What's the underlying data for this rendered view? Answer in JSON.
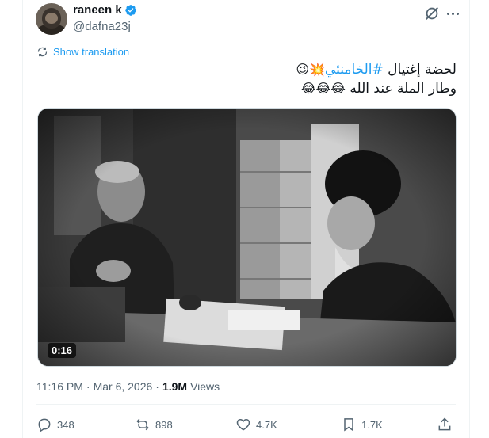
{
  "author": {
    "display_name": "raneen k",
    "handle": "@dafna23j",
    "verified": true
  },
  "translate": {
    "label": "Show translation"
  },
  "tweet": {
    "line1_prefix": "لحضة إغتيال ",
    "line1_hashtag": "#الخامنئي",
    "line1_emojis": "💥😉",
    "line2_text": "وطار الملة عند الله ",
    "line2_emojis": "😂😂😂"
  },
  "media": {
    "duration": "0:16"
  },
  "meta": {
    "time": "11:16 PM",
    "separator1": "·",
    "date": "Mar 6, 2026",
    "separator2": "·",
    "views_count": "1.9M",
    "views_label": "Views"
  },
  "actions": {
    "replies": "348",
    "reposts": "898",
    "likes": "4.7K",
    "bookmarks": "1.7K"
  },
  "colors": {
    "accent": "#1d9bf0",
    "secondary_text": "#536471",
    "primary_text": "#0f1419"
  },
  "icons": [
    "verified-badge-icon",
    "grok-icon",
    "more-icon",
    "translate-icon",
    "reply-icon",
    "repost-icon",
    "like-icon",
    "bookmark-icon",
    "share-icon"
  ]
}
